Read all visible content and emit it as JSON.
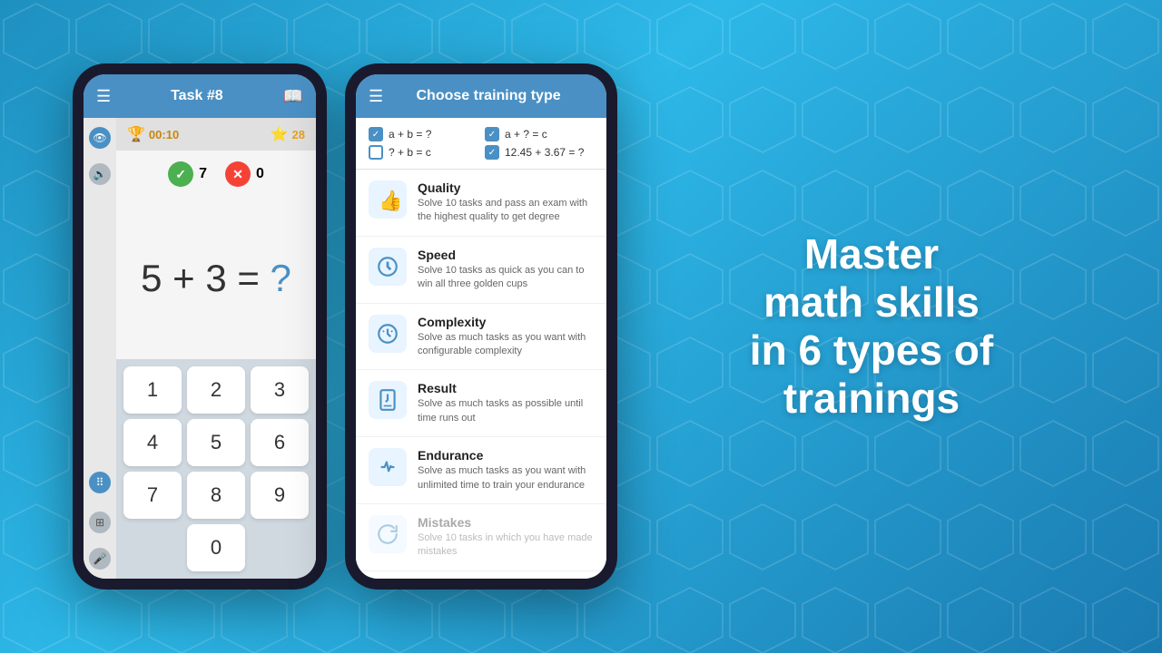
{
  "background": {
    "color": "#2299cc"
  },
  "phone_left": {
    "app_bar": {
      "menu_label": "☰",
      "title": "Task #8",
      "book_label": "📖"
    },
    "stats": {
      "trophy": "🏆",
      "time": "00:10",
      "star": "⭐",
      "stars_count": "28"
    },
    "score": {
      "correct": "7",
      "wrong": "0"
    },
    "math_problem": "5 + 3 = ?",
    "math_display": [
      "5",
      "+",
      "3",
      "=",
      "?"
    ],
    "keys": [
      "1",
      "2",
      "3",
      "4",
      "5",
      "6",
      "7",
      "8",
      "9",
      "0"
    ]
  },
  "phone_right": {
    "app_bar": {
      "menu_label": "☰",
      "title": "Choose training type"
    },
    "checkboxes": [
      {
        "label": "a + b = ?",
        "checked": true
      },
      {
        "label": "a + ? = c",
        "checked": true
      },
      {
        "label": "? + b = c",
        "checked": false
      },
      {
        "label": "12.45 + 3.67 = ?",
        "checked": true
      }
    ],
    "training_items": [
      {
        "name": "Quality",
        "desc": "Solve 10 tasks and pass an exam with the highest quality to get degree",
        "icon": "👍",
        "dimmed": false
      },
      {
        "name": "Speed",
        "desc": "Solve 10 tasks as quick as you can to win all three golden cups",
        "icon": "⏱",
        "dimmed": false
      },
      {
        "name": "Complexity",
        "desc": "Solve as much tasks as you want with configurable complexity",
        "icon": "🕹",
        "dimmed": false
      },
      {
        "name": "Result",
        "desc": "Solve as much tasks as possible until time runs out",
        "icon": "⏳",
        "dimmed": false
      },
      {
        "name": "Endurance",
        "desc": "Solve as much tasks as you want with unlimited time to train your endurance",
        "icon": "🏋",
        "dimmed": false
      },
      {
        "name": "Mistakes",
        "desc": "Solve 10 tasks in which you have made mistakes",
        "icon": "🔄",
        "dimmed": true
      }
    ]
  },
  "hero_text": {
    "line1": "Master",
    "line2": "math skills",
    "line3": "in 6 types of",
    "line4": "trainings"
  }
}
